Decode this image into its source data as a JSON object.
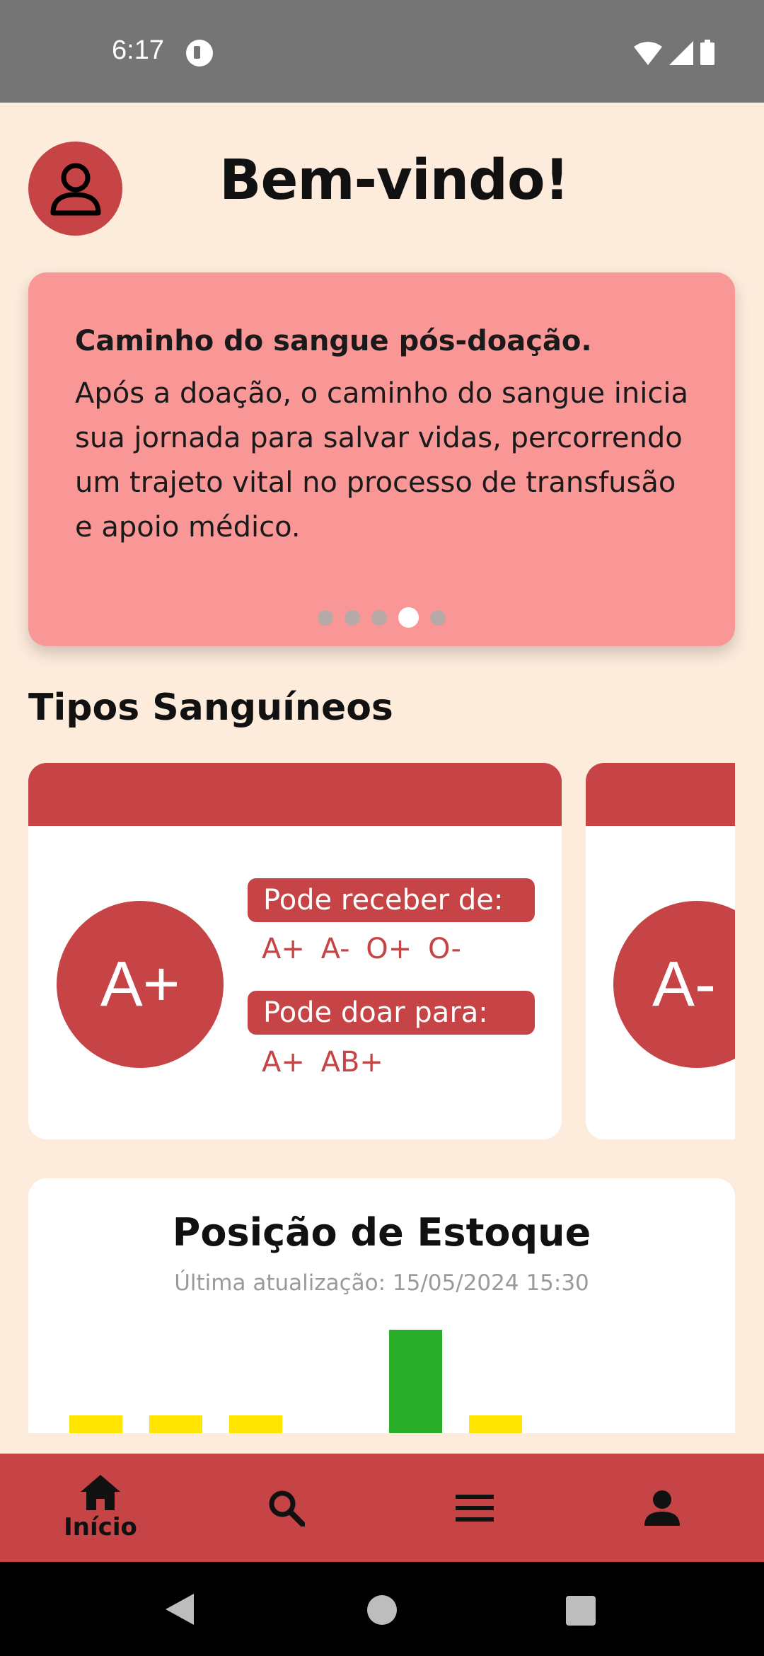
{
  "status_bar": {
    "time": "6:17"
  },
  "header": {
    "welcome": "Bem-vindo!"
  },
  "carousel": {
    "title": "Caminho do sangue pós-doação.",
    "text": "Após a doação, o caminho do sangue inicia sua jornada para salvar vidas, percorrendo um trajeto vital no processo de transfusão e apoio médico.",
    "dot_count": 5,
    "active_dot": 4
  },
  "blood_types": {
    "section_title": "Tipos Sanguíneos",
    "cards": [
      {
        "type": "A+",
        "receive_label": "Pode receber de:",
        "receive_from": "A+ A- O+ O-",
        "donate_label": "Pode doar para:",
        "donate_to": "A+ AB+"
      },
      {
        "type": "A-"
      }
    ]
  },
  "stock": {
    "title": "Posição de Estoque",
    "updated": "Última atualização: 15/05/2024 15:30"
  },
  "chart_data": {
    "type": "bar",
    "title": "Posição de Estoque",
    "series": [
      {
        "values": [
          1,
          1,
          1,
          0,
          4,
          1
        ]
      }
    ],
    "colors": [
      "#ffe600",
      "#ffe600",
      "#ffe600",
      "#ffe600",
      "#2aae2a",
      "#ffe600"
    ],
    "note_visible": "chart partially visible; bars cut off at bottom"
  },
  "bottom_nav": {
    "items": [
      {
        "label": "Início",
        "icon": "home-icon",
        "active": true
      },
      {
        "label": "",
        "icon": "search-icon"
      },
      {
        "label": "",
        "icon": "menu-icon"
      },
      {
        "label": "",
        "icon": "person-icon"
      }
    ]
  },
  "colors": {
    "background": "#fdebdc",
    "primary": "#c74446",
    "carousel": "#f99696"
  }
}
